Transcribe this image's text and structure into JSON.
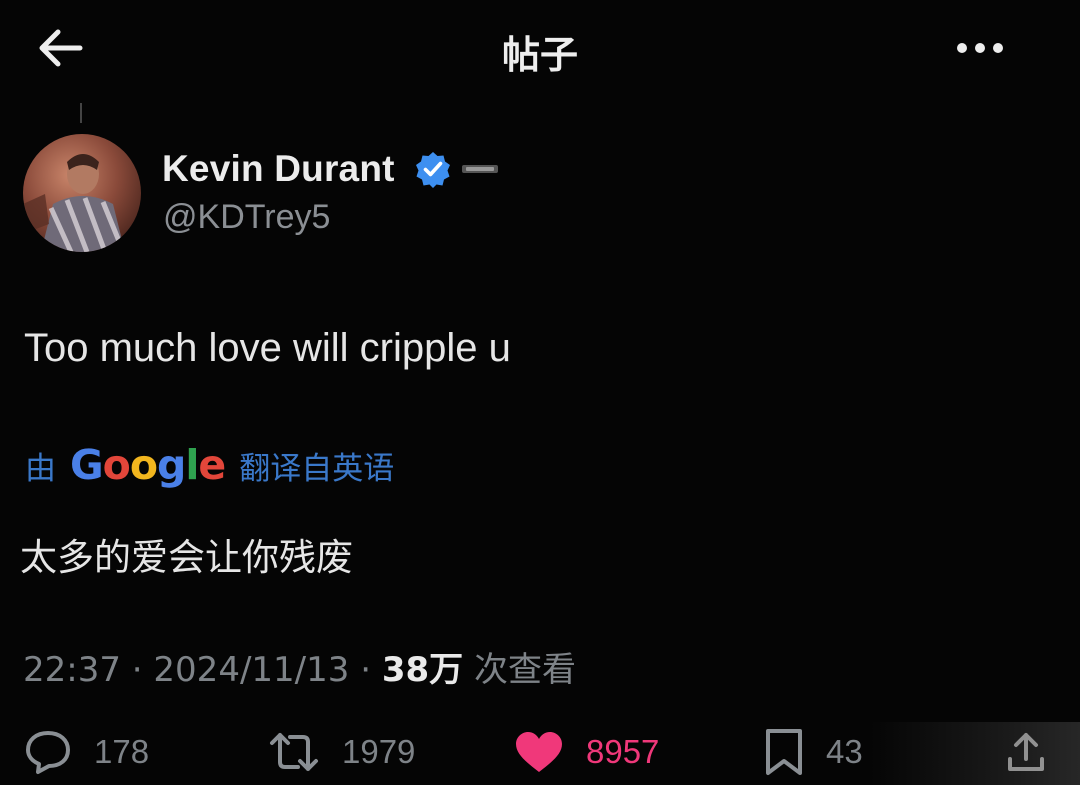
{
  "header": {
    "title": "帖子"
  },
  "author": {
    "display_name": "Kevin Durant",
    "handle": "@KDTrey5",
    "verified": true
  },
  "tweet": {
    "text": "Too much love will cripple u",
    "translation_prefix": "由",
    "translation_provider": "Google",
    "translation_suffix": "翻译自英语",
    "translated_text": "太多的爱会让你残废"
  },
  "meta": {
    "time": "22:37",
    "separator": "·",
    "date": "2024/11/13",
    "views_count": "38万",
    "views_label": "次查看"
  },
  "actions": {
    "replies": "178",
    "reposts": "1979",
    "likes": "8957",
    "bookmarks": "43"
  },
  "colors": {
    "background": "#050505",
    "link_blue": "#3a78c9",
    "verified_blue": "#3d8ff0",
    "like_pink": "#f0387a",
    "muted_gray": "#7e8388"
  }
}
